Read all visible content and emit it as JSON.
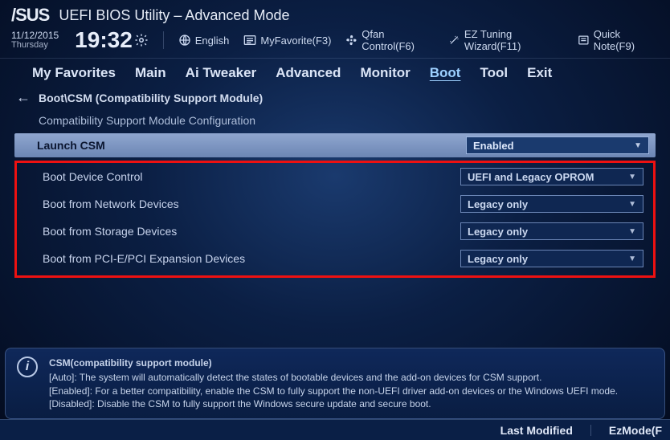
{
  "brand": "/SUS",
  "app_title": "UEFI BIOS Utility – Advanced Mode",
  "datetime": {
    "date": "11/12/2015",
    "day": "Thursday",
    "time": "19:32"
  },
  "topbuttons": {
    "language": "English",
    "myfav": "MyFavorite(F3)",
    "qfan": "Qfan Control(F6)",
    "eztune": "EZ Tuning Wizard(F11)",
    "quicknote": "Quick Note(F9)"
  },
  "tabs": [
    "My Favorites",
    "Main",
    "Ai Tweaker",
    "Advanced",
    "Monitor",
    "Boot",
    "Tool",
    "Exit"
  ],
  "active_tab": "Boot",
  "breadcrumb": "Boot\\CSM (Compatibility Support Module)",
  "section_title": "Compatibility Support Module Configuration",
  "rows": [
    {
      "label": "Launch CSM",
      "value": "Enabled",
      "selected": true
    },
    {
      "label": "Boot Device Control",
      "value": "UEFI and Legacy OPROM"
    },
    {
      "label": "Boot from Network Devices",
      "value": "Legacy only"
    },
    {
      "label": "Boot from Storage Devices",
      "value": "Legacy only"
    },
    {
      "label": "Boot from PCI-E/PCI Expansion Devices",
      "value": "Legacy only"
    }
  ],
  "help": {
    "title": "CSM(compatibility support module)",
    "auto": "[Auto]: The system will automatically detect the states of bootable devices and the add-on devices for CSM support.",
    "enabled": "[Enabled]: For a better compatibility, enable the CSM to fully support the non-UEFI driver add-on devices or the Windows UEFI mode.",
    "disabled": "[Disabled]: Disable the CSM to fully support the Windows secure update and secure boot."
  },
  "footer": {
    "lastmod": "Last Modified",
    "ezmode": "EzMode(F"
  }
}
